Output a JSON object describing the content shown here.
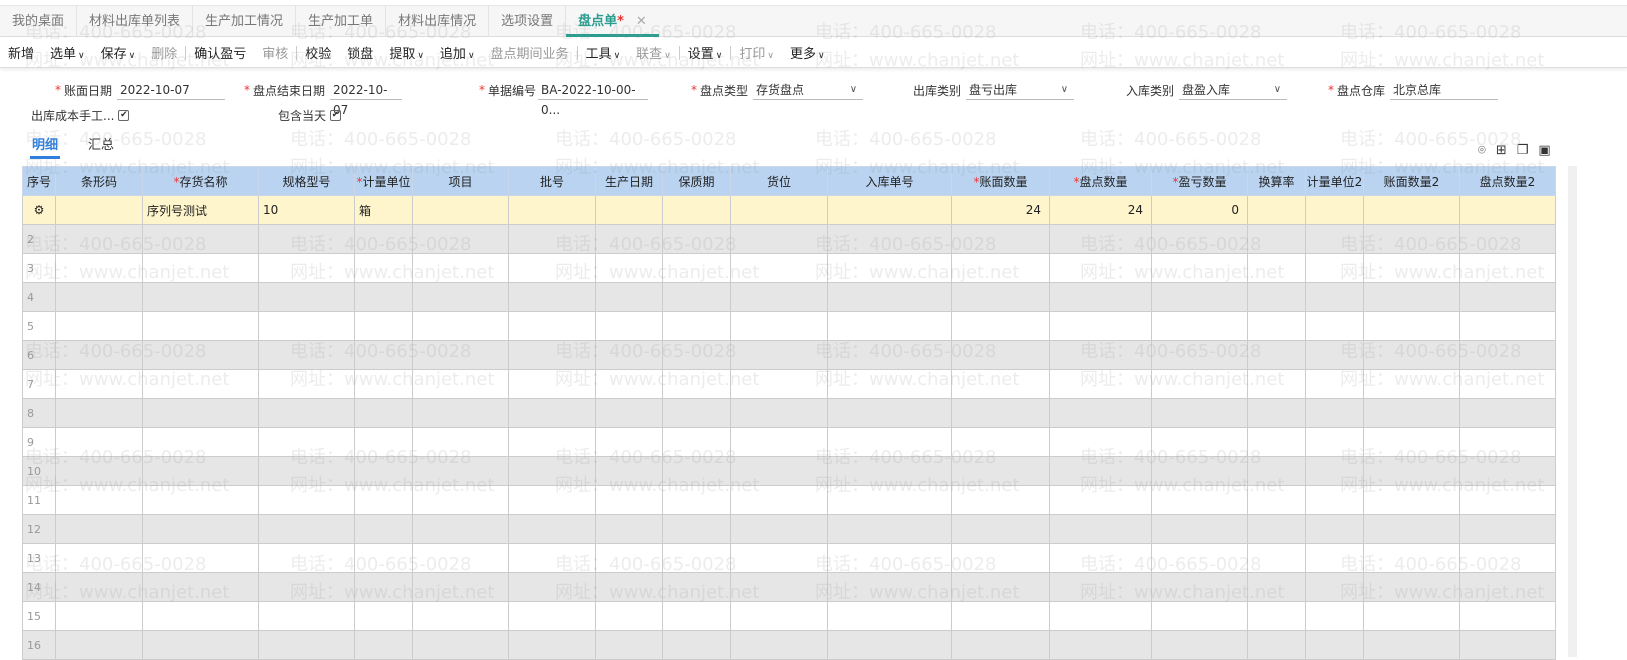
{
  "tabs": [
    {
      "label": "我的桌面"
    },
    {
      "label": "材料出库单列表"
    },
    {
      "label": "生产加工情况"
    },
    {
      "label": "生产加工单"
    },
    {
      "label": "材料出库情况"
    },
    {
      "label": "选项设置"
    },
    {
      "label": "盘点单",
      "modified": "*",
      "close": "✕"
    }
  ],
  "toolbar": [
    {
      "label": "新增"
    },
    {
      "label": "选单",
      "caret": "∨"
    },
    {
      "label": "保存",
      "caret": "∨"
    },
    {
      "label": "删除",
      "disabled": true
    },
    {
      "label": "确认盈亏"
    },
    {
      "label": "审核",
      "disabled": true
    },
    {
      "label": "校验"
    },
    {
      "label": "锁盘"
    },
    {
      "label": "提取",
      "caret": "∨"
    },
    {
      "label": "追加",
      "caret": "∨"
    },
    {
      "label": "盘点期间业务",
      "disabled": true
    },
    {
      "label": "工具",
      "caret": "∨"
    },
    {
      "label": "联查",
      "caret": "∨",
      "disabled": true
    },
    {
      "label": "设置",
      "caret": "∨"
    },
    {
      "label": "打印",
      "caret": "∨",
      "disabled": true
    },
    {
      "label": "更多",
      "caret": "∨"
    }
  ],
  "form": {
    "book_date": {
      "label": "账面日期",
      "value": "2022-10-07"
    },
    "end_date": {
      "label": "盘点结束日期",
      "value": "2022-10-07"
    },
    "doc_no": {
      "label": "单据编号",
      "value": "BA-2022-10-00-0..."
    },
    "type": {
      "label": "盘点类型",
      "value": "存货盘点"
    },
    "out_type": {
      "label": "出库类别",
      "value": "盘亏出库"
    },
    "in_type": {
      "label": "入库类别",
      "value": "盘盈入库"
    },
    "warehouse": {
      "label": "盘点仓库",
      "value": "北京总库"
    },
    "manual_cost": {
      "label": "出库成本手工...",
      "checked": true
    },
    "include_day": {
      "label": "包含当天",
      "checked": true
    },
    "required_mark": "*",
    "check_mark": "✔",
    "chevron": "∨"
  },
  "subtabs": {
    "detail": "明细",
    "summary": "汇总"
  },
  "table": {
    "headers": [
      "序号",
      "条形码",
      "存货名称",
      "规格型号",
      "计量单位",
      "项目",
      "批号",
      "生产日期",
      "保质期",
      "货位",
      "入库单号",
      "账面数量",
      "盘点数量",
      "盈亏数量",
      "换算率",
      "计量单位2",
      "账面数量2",
      "盘点数量2"
    ],
    "required": [
      false,
      false,
      true,
      false,
      true,
      false,
      false,
      false,
      false,
      false,
      false,
      true,
      true,
      true,
      false,
      false,
      false,
      false
    ],
    "rows": [
      {
        "idx": "⚙",
        "name": "序列号测试",
        "spec": "10",
        "unit": "箱",
        "book_qty": "24",
        "count_qty": "24",
        "diff_qty": "0"
      },
      {
        "idx": "2"
      },
      {
        "idx": "3"
      },
      {
        "idx": "4"
      },
      {
        "idx": "5"
      },
      {
        "idx": "6"
      },
      {
        "idx": "7"
      },
      {
        "idx": "8"
      },
      {
        "idx": "9"
      },
      {
        "idx": "10"
      },
      {
        "idx": "11"
      },
      {
        "idx": "12"
      },
      {
        "idx": "13"
      },
      {
        "idx": "14"
      },
      {
        "idx": "15"
      },
      {
        "idx": "16"
      }
    ]
  },
  "watermark": {
    "phone": "电话：400-665-0028",
    "site": "网址：www.chanjet.net"
  }
}
